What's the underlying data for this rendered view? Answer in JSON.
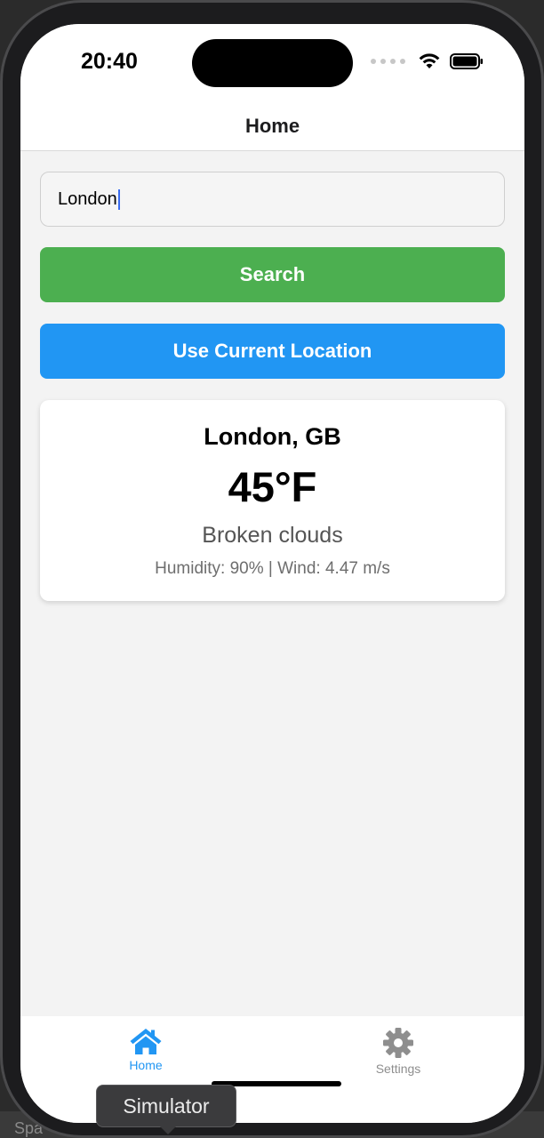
{
  "status_bar": {
    "time": "20:40"
  },
  "header": {
    "title": "Home"
  },
  "search": {
    "value": "London"
  },
  "buttons": {
    "search_label": "Search",
    "location_label": "Use Current Location"
  },
  "weather": {
    "location": "London, GB",
    "temperature": "45°F",
    "description": "Broken clouds",
    "details": "Humidity: 90% | Wind: 4.47 m/s"
  },
  "tabs": [
    {
      "label": "Home",
      "icon": "home-icon",
      "active": true
    },
    {
      "label": "Settings",
      "icon": "gear-icon",
      "active": false
    }
  ],
  "tooltip": {
    "text": "Simulator"
  },
  "desktop": {
    "partial_text": "Spa"
  },
  "colors": {
    "search_button": "#4caf50",
    "location_button": "#2196f3",
    "active_tab": "#2196f3",
    "inactive_tab": "#8e8e8e"
  }
}
